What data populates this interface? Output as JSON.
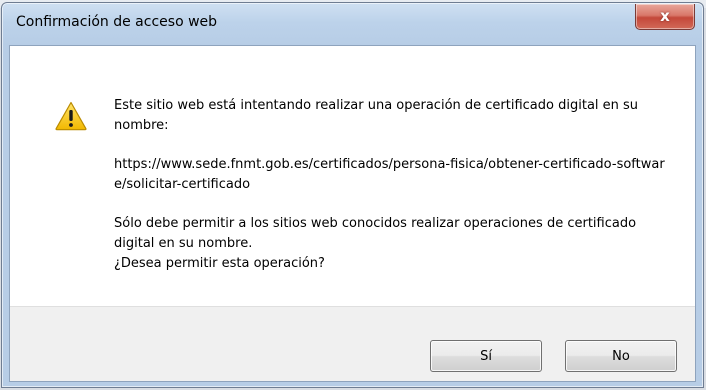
{
  "window": {
    "title": "Confirmación de acceso web",
    "close_label": "x"
  },
  "icon": {
    "name": "warning-icon",
    "color": "#f2c200"
  },
  "message": {
    "line1": "Este sitio web está intentando realizar una operación de certificado digital en su nombre:",
    "url": "https://www.sede.fnmt.gob.es/certificados/persona-fisica/obtener-certificado-software/solicitar-certificado",
    "line2": "Sólo debe permitir a los sitios web conocidos realizar operaciones de certificado digital en su nombre.",
    "question": "¿Desea permitir esta operación?"
  },
  "buttons": {
    "yes_label": "Sí",
    "no_label": "No"
  },
  "colors": {
    "titlebar": "#bcd2ea",
    "close_button": "#c4483a",
    "footer": "#f0f0f0"
  }
}
